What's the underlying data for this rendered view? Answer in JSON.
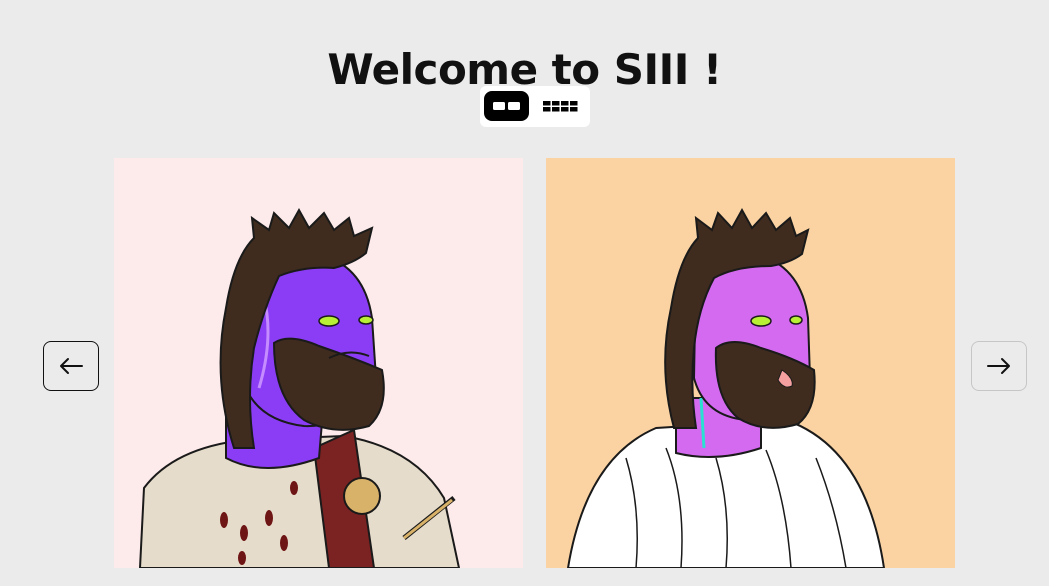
{
  "header": {
    "title": "Welcome to SIII !"
  },
  "view_toggle": {
    "options": [
      {
        "name": "two-column-view",
        "active": true
      },
      {
        "name": "four-column-view",
        "active": false
      }
    ]
  },
  "carousel": {
    "prev_icon": "arrow-left-icon",
    "next_icon": "arrow-right-icon",
    "items": [
      {
        "background": "#fdeaea",
        "skin": "#8a3df5",
        "garment": "#e6dccb"
      },
      {
        "background": "#fbd3a2",
        "skin": "#d36af0",
        "garment": "#ffffff"
      }
    ]
  },
  "colors": {
    "page_background": "#ebebeb",
    "toggle_active": "#000000",
    "hair": "#3f2c1f",
    "eyes": "#b8f035"
  }
}
